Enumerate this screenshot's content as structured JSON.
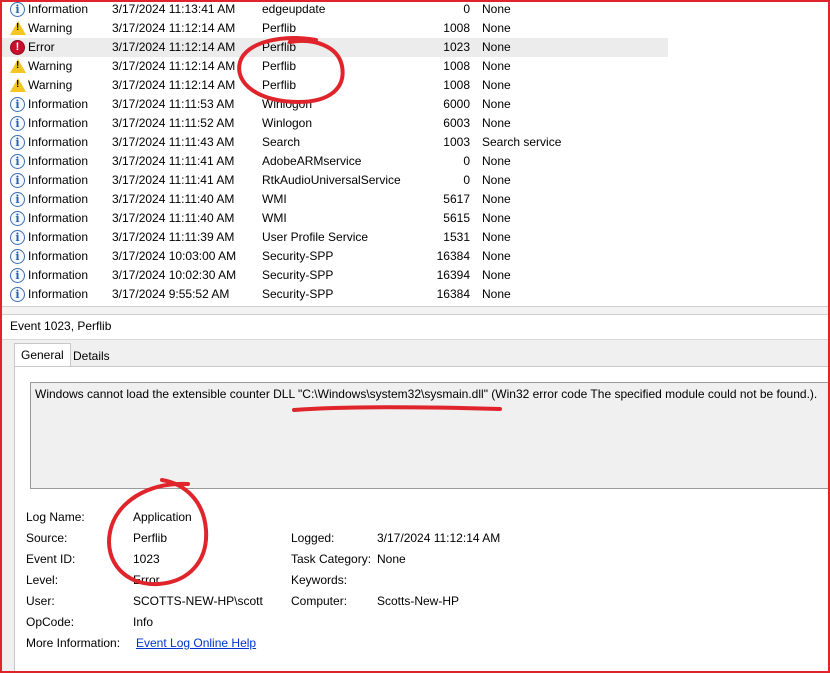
{
  "event_list": {
    "rows": [
      {
        "level": "Information",
        "level_icon": "information-icon",
        "date": "3/17/2024 11:13:41 AM",
        "source": "edgeupdate",
        "event_id": "0",
        "task": "None"
      },
      {
        "level": "Warning",
        "level_icon": "warning-icon",
        "date": "3/17/2024 11:12:14 AM",
        "source": "Perflib",
        "event_id": "1008",
        "task": "None"
      },
      {
        "level": "Error",
        "level_icon": "error-icon",
        "date": "3/17/2024 11:12:14 AM",
        "source": "Perflib",
        "event_id": "1023",
        "task": "None",
        "selected": true
      },
      {
        "level": "Warning",
        "level_icon": "warning-icon",
        "date": "3/17/2024 11:12:14 AM",
        "source": "Perflib",
        "event_id": "1008",
        "task": "None"
      },
      {
        "level": "Warning",
        "level_icon": "warning-icon",
        "date": "3/17/2024 11:12:14 AM",
        "source": "Perflib",
        "event_id": "1008",
        "task": "None"
      },
      {
        "level": "Information",
        "level_icon": "information-icon",
        "date": "3/17/2024 11:11:53 AM",
        "source": "Winlogon",
        "event_id": "6000",
        "task": "None"
      },
      {
        "level": "Information",
        "level_icon": "information-icon",
        "date": "3/17/2024 11:11:52 AM",
        "source": "Winlogon",
        "event_id": "6003",
        "task": "None"
      },
      {
        "level": "Information",
        "level_icon": "information-icon",
        "date": "3/17/2024 11:11:43 AM",
        "source": "Search",
        "event_id": "1003",
        "task": "Search service"
      },
      {
        "level": "Information",
        "level_icon": "information-icon",
        "date": "3/17/2024 11:11:41 AM",
        "source": "AdobeARMservice",
        "event_id": "0",
        "task": "None"
      },
      {
        "level": "Information",
        "level_icon": "information-icon",
        "date": "3/17/2024 11:11:41 AM",
        "source": "RtkAudioUniversalService",
        "event_id": "0",
        "task": "None"
      },
      {
        "level": "Information",
        "level_icon": "information-icon",
        "date": "3/17/2024 11:11:40 AM",
        "source": "WMI",
        "event_id": "5617",
        "task": "None"
      },
      {
        "level": "Information",
        "level_icon": "information-icon",
        "date": "3/17/2024 11:11:40 AM",
        "source": "WMI",
        "event_id": "5615",
        "task": "None"
      },
      {
        "level": "Information",
        "level_icon": "information-icon",
        "date": "3/17/2024 11:11:39 AM",
        "source": "User Profile Service",
        "event_id": "1531",
        "task": "None"
      },
      {
        "level": "Information",
        "level_icon": "information-icon",
        "date": "3/17/2024 10:03:00 AM",
        "source": "Security-SPP",
        "event_id": "16384",
        "task": "None"
      },
      {
        "level": "Information",
        "level_icon": "information-icon",
        "date": "3/17/2024 10:02:30 AM",
        "source": "Security-SPP",
        "event_id": "16394",
        "task": "None"
      },
      {
        "level": "Information",
        "level_icon": "information-icon",
        "date": "3/17/2024 9:55:52 AM",
        "source": "Security-SPP",
        "event_id": "16384",
        "task": "None"
      }
    ]
  },
  "details": {
    "title": "Event 1023, Perflib",
    "tabs": {
      "general": "General",
      "details": "Details"
    },
    "message": "Windows cannot load the extensible counter DLL \"C:\\Windows\\system32\\sysmain.dll\" (Win32 error code The specified module could not be found.).",
    "labels": {
      "log_name": "Log Name:",
      "source": "Source:",
      "event_id": "Event ID:",
      "level": "Level:",
      "user": "User:",
      "opcode": "OpCode:",
      "more_info": "More Information:",
      "logged": "Logged:",
      "task_category": "Task Category:",
      "keywords": "Keywords:",
      "computer": "Computer:"
    },
    "values": {
      "log_name": "Application",
      "source": "Perflib",
      "event_id": "1023",
      "level": "Error",
      "user": "SCOTTS-NEW-HP\\scott",
      "opcode": "Info",
      "more_info": "Event Log Online Help",
      "logged": "3/17/2024 11:12:14 AM",
      "task_category": "None",
      "keywords": "",
      "computer": "Scotts-New-HP"
    }
  },
  "colors": {
    "annotation": "#e0242b",
    "frame": "#e0242b",
    "link": "#0033cc",
    "selected_row": "#ececec"
  }
}
